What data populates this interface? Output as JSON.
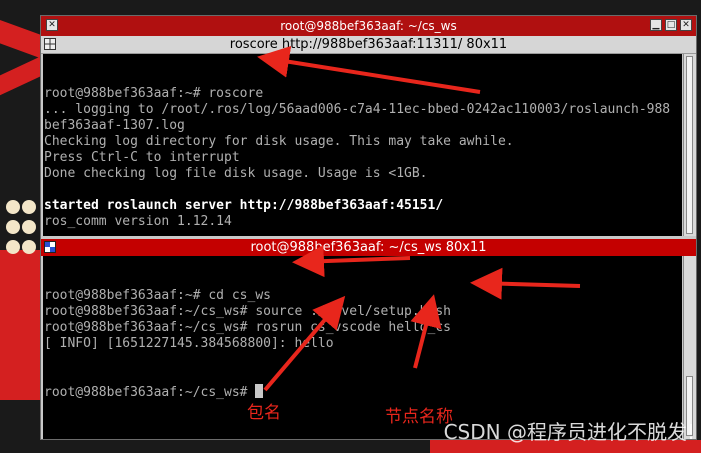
{
  "window": {
    "title": "root@988bef363aaf: ~/cs_ws",
    "buttons": [
      "minimize",
      "maximize",
      "close"
    ]
  },
  "top_pane": {
    "title": "roscore http://988bef363aaf:11311/ 80x11",
    "lines": [
      {
        "text": "root@988bef363aaf:~# roscore",
        "bold": false
      },
      {
        "text": "... logging to /root/.ros/log/56aad006-c7a4-11ec-bbed-0242ac110003/roslaunch-988",
        "bold": false
      },
      {
        "text": "bef363aaf-1307.log",
        "bold": false
      },
      {
        "text": "Checking log directory for disk usage. This may take awhile.",
        "bold": false
      },
      {
        "text": "Press Ctrl-C to interrupt",
        "bold": false
      },
      {
        "text": "Done checking log file disk usage. Usage is <1GB.",
        "bold": false
      },
      {
        "text": "",
        "bold": false
      },
      {
        "text": "started roslaunch server http://988bef363aaf:45151/",
        "bold": true
      },
      {
        "text": "ros_comm version 1.12.14",
        "bold": false
      }
    ]
  },
  "bottom_pane": {
    "title": "root@988bef363aaf: ~/cs_ws 80x11",
    "lines": [
      {
        "text": "root@988bef363aaf:~# cd cs_ws"
      },
      {
        "text": "root@988bef363aaf:~/cs_ws# source ./devel/setup.bash"
      },
      {
        "text": "root@988bef363aaf:~/cs_ws# rosrun cs_vscode hello_cs"
      },
      {
        "text": "[ INFO] [1651227145.384568800]: hello"
      }
    ],
    "prompt": "root@988bef363aaf:~/cs_ws# "
  },
  "annotations": {
    "package_label": "包名",
    "node_label": "节点名称"
  },
  "watermark": "CSDN @程序员进化不脱发!",
  "colors": {
    "title_red": "#b01010",
    "active_pane_red": "#c40000",
    "terminal_bg": "#000000",
    "terminal_fg": "#b0b0b0",
    "annotation_red": "#e8261c"
  }
}
